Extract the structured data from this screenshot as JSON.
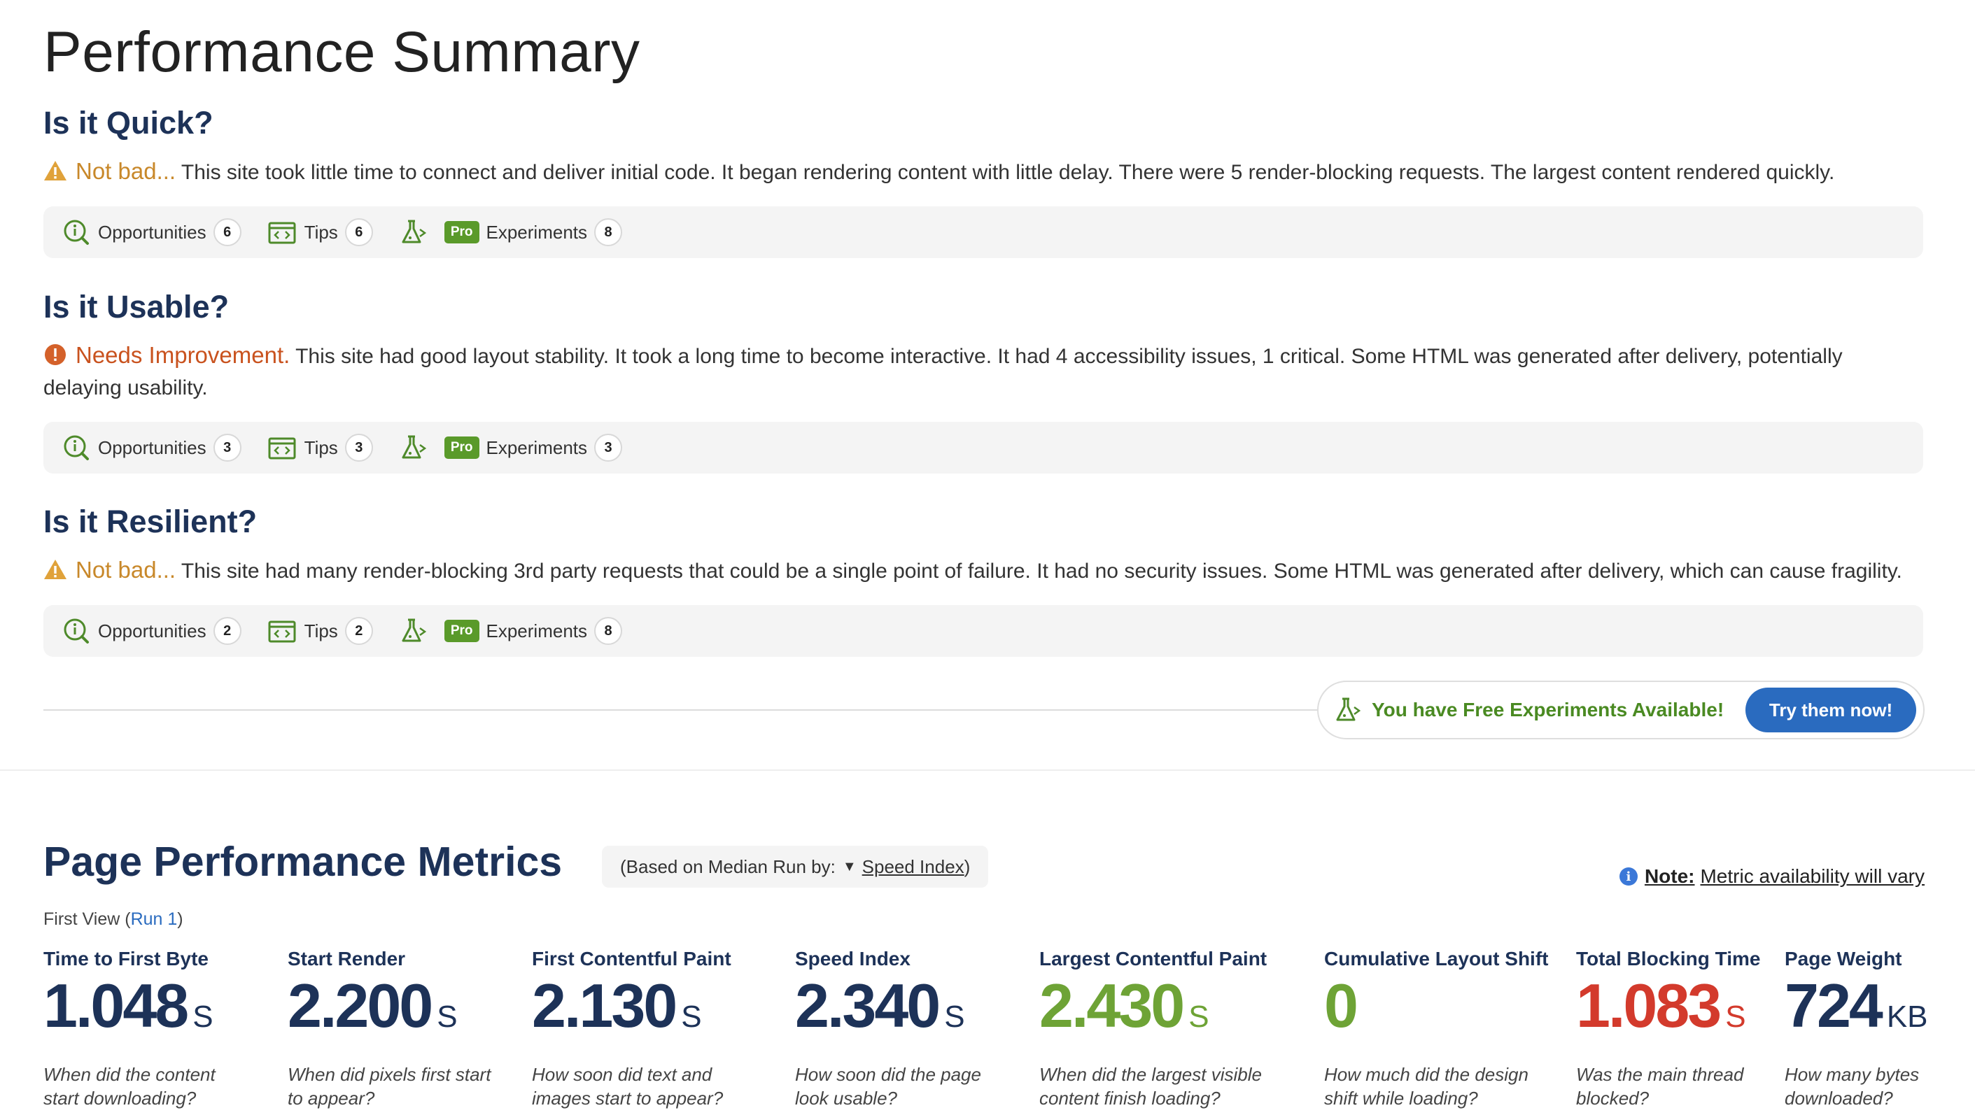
{
  "page_title": "Performance Summary",
  "sections": [
    {
      "heading": "Is it Quick?",
      "verdict": "Not bad...",
      "verdict_type": "warning",
      "description": "This site took little time to connect and deliver initial code. It began rendering content with little delay. There were 5 render-blocking requests. The largest content rendered quickly.",
      "opportunities_label": "Opportunities",
      "opportunities_count": "6",
      "tips_label": "Tips",
      "tips_count": "6",
      "pro_label": "Pro",
      "experiments_label": "Experiments",
      "experiments_count": "8"
    },
    {
      "heading": "Is it Usable?",
      "verdict": "Needs Improvement.",
      "verdict_type": "error",
      "description": "This site had good layout stability. It took a long time to become interactive. It had 4 accessibility issues, 1 critical. Some HTML was generated after delivery, potentially delaying usability.",
      "opportunities_label": "Opportunities",
      "opportunities_count": "3",
      "tips_label": "Tips",
      "tips_count": "3",
      "pro_label": "Pro",
      "experiments_label": "Experiments",
      "experiments_count": "3"
    },
    {
      "heading": "Is it Resilient?",
      "verdict": "Not bad...",
      "verdict_type": "warning",
      "description": "This site had many render-blocking 3rd party requests that could be a single point of failure. It had no security issues. Some HTML was generated after delivery, which can cause fragility.",
      "opportunities_label": "Opportunities",
      "opportunities_count": "2",
      "tips_label": "Tips",
      "tips_count": "2",
      "pro_label": "Pro",
      "experiments_label": "Experiments",
      "experiments_count": "8"
    }
  ],
  "free_experiments": {
    "text": "You have Free Experiments Available!",
    "button": "Try them now!"
  },
  "metrics_section": {
    "heading": "Page Performance Metrics",
    "median_prefix": "(Based on Median Run by:",
    "median_link": "Speed Index",
    "median_suffix": ")",
    "note_bold": "Note:",
    "note_text": "Metric availability will vary",
    "first_view_prefix": "First View (",
    "first_view_link": "Run 1",
    "first_view_suffix": ")"
  },
  "metrics": [
    {
      "label": "Time to First Byte",
      "value": "1.048",
      "unit": "S",
      "q1": "When did the content",
      "q2": "start downloading?",
      "color": "#1d3258"
    },
    {
      "label": "Start Render",
      "value": "2.200",
      "unit": "S",
      "q1": "When did pixels first start",
      "q2": "to appear?",
      "color": "#1d3258"
    },
    {
      "label": "First Contentful Paint",
      "value": "2.130",
      "unit": "S",
      "q1": "How soon did text and",
      "q2": "images start to appear?",
      "color": "#1d3258"
    },
    {
      "label": "Speed Index",
      "value": "2.340",
      "unit": "S",
      "q1": "How soon did the page",
      "q2": "look usable?",
      "color": "#1d3258"
    },
    {
      "label": "Largest Contentful Paint",
      "value": "2.430",
      "unit": "S",
      "q1": "When did the largest visible",
      "q2": "content finish loading?",
      "color": "#6ea336"
    },
    {
      "label": "Cumulative Layout Shift",
      "value": "0",
      "unit": "",
      "q1": "How much did the design",
      "q2": "shift while loading?",
      "color": "#6ea336"
    },
    {
      "label": "Total Blocking Time",
      "value": "1.083",
      "unit": "S",
      "q1": "Was the main thread",
      "q2": "blocked?",
      "color": "#d33a2c"
    },
    {
      "label": "Page Weight",
      "value": "724",
      "unit": "KB",
      "q1": "How many bytes",
      "q2": "downloaded?",
      "color": "#1d3258"
    }
  ],
  "icons": {
    "warning": "warning-triangle-icon",
    "error": "error-circle-icon",
    "opportunities": "magnifier-info-icon",
    "tips": "code-window-icon",
    "experiments": "flask-icon",
    "note": "info-icon"
  }
}
